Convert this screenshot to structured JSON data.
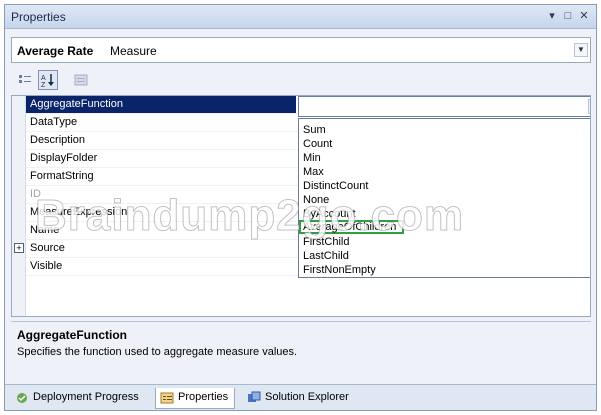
{
  "window": {
    "title": "Properties",
    "controls": [
      "▾",
      "□",
      "✕"
    ]
  },
  "object_selector": {
    "name": "Average Rate",
    "type": "Measure"
  },
  "toolbar": {
    "categorized_icon": "categorized-icon",
    "alphabetical_icon": "alphabetical-icon",
    "property_pages_icon": "property-pages-icon"
  },
  "properties": [
    {
      "name": "AggregateFunction",
      "selected": true
    },
    {
      "name": "DataType"
    },
    {
      "name": "Description"
    },
    {
      "name": "DisplayFolder"
    },
    {
      "name": "FormatString"
    },
    {
      "name": "ID",
      "dim": true
    },
    {
      "name": "MeasureExpression"
    },
    {
      "name": "Name"
    },
    {
      "name": "Source",
      "expandable": true
    },
    {
      "name": "Visible"
    }
  ],
  "editor": {
    "value": "",
    "options": [
      "Sum",
      "Count",
      "Min",
      "Max",
      "DistinctCount",
      "None",
      "ByAccount",
      "AverageOfChildren",
      "FirstChild",
      "LastChild",
      "FirstNonEmpty"
    ],
    "highlighted": "AverageOfChildren"
  },
  "description": {
    "title": "AggregateFunction",
    "text": "Specifies the function used to aggregate measure values."
  },
  "tabs": [
    {
      "label": "Deployment Progress",
      "icon": "deployment-icon",
      "active": false
    },
    {
      "label": "Properties",
      "icon": "properties-icon",
      "active": true
    },
    {
      "label": "Solution Explorer",
      "icon": "solution-explorer-icon",
      "active": false
    }
  ],
  "watermark": "Braindump2go.com"
}
